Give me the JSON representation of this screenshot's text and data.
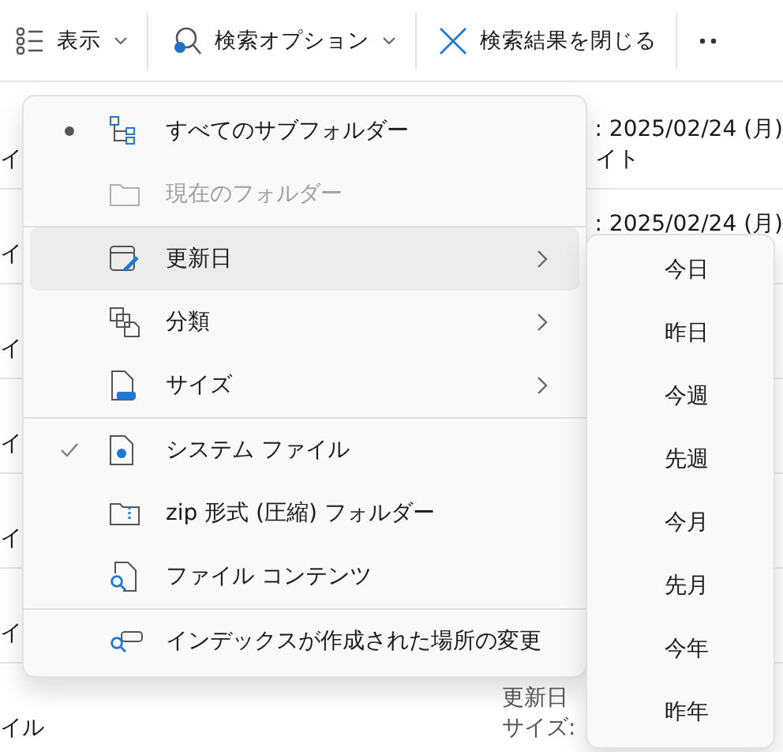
{
  "toolbar": {
    "items": [
      {
        "kind": "dropdown",
        "label": "表示"
      },
      {
        "kind": "dropdown",
        "label": "検索オプション"
      },
      {
        "kind": "action",
        "label": "検索結果を閉じる"
      }
    ]
  },
  "file_rows": [
    {
      "name": "イ",
      "line_1": ": 2025/02/24 (月)",
      "line_2": "イト",
      "kind": "right"
    },
    {
      "name": "イ",
      "line_1": ": 2025/02/24 (月)",
      "kind": "right"
    },
    {
      "name": "イ"
    },
    {
      "name": "イ"
    },
    {
      "name": "イ"
    },
    {
      "name": "イ"
    },
    {
      "name": "イル",
      "line_1": "更新日",
      "line_2": "サイズ:",
      "kind": "left"
    }
  ],
  "menu": {
    "items": [
      {
        "kind": "radio",
        "label": "すべてのサブフォルダー",
        "selected": true,
        "disabled": false,
        "highlighted": false
      },
      {
        "kind": "radio",
        "label": "現在のフォルダー",
        "selected": false,
        "disabled": true,
        "highlighted": false
      },
      {
        "kind": "divider"
      },
      {
        "kind": "submenu",
        "label": "更新日",
        "highlighted": true,
        "disabled": false
      },
      {
        "kind": "submenu",
        "label": "分類",
        "highlighted": false,
        "disabled": false
      },
      {
        "kind": "submenu",
        "label": "サイズ",
        "highlighted": false,
        "disabled": false
      },
      {
        "kind": "divider"
      },
      {
        "kind": "toggle",
        "label": "システム ファイル",
        "checked": true,
        "disabled": false,
        "highlighted": false
      },
      {
        "kind": "toggle",
        "label": "zip 形式 (圧縮) フォルダー",
        "checked": false,
        "disabled": false,
        "highlighted": false
      },
      {
        "kind": "toggle",
        "label": "ファイル コンテンツ",
        "checked": false,
        "disabled": false,
        "highlighted": false
      },
      {
        "kind": "divider"
      },
      {
        "kind": "action",
        "label": "インデックスが作成された場所の変更",
        "disabled": false,
        "highlighted": false
      }
    ]
  },
  "submenu": {
    "items": [
      "今日",
      "昨日",
      "今週",
      "先週",
      "今月",
      "先月",
      "今年",
      "昨年"
    ]
  }
}
